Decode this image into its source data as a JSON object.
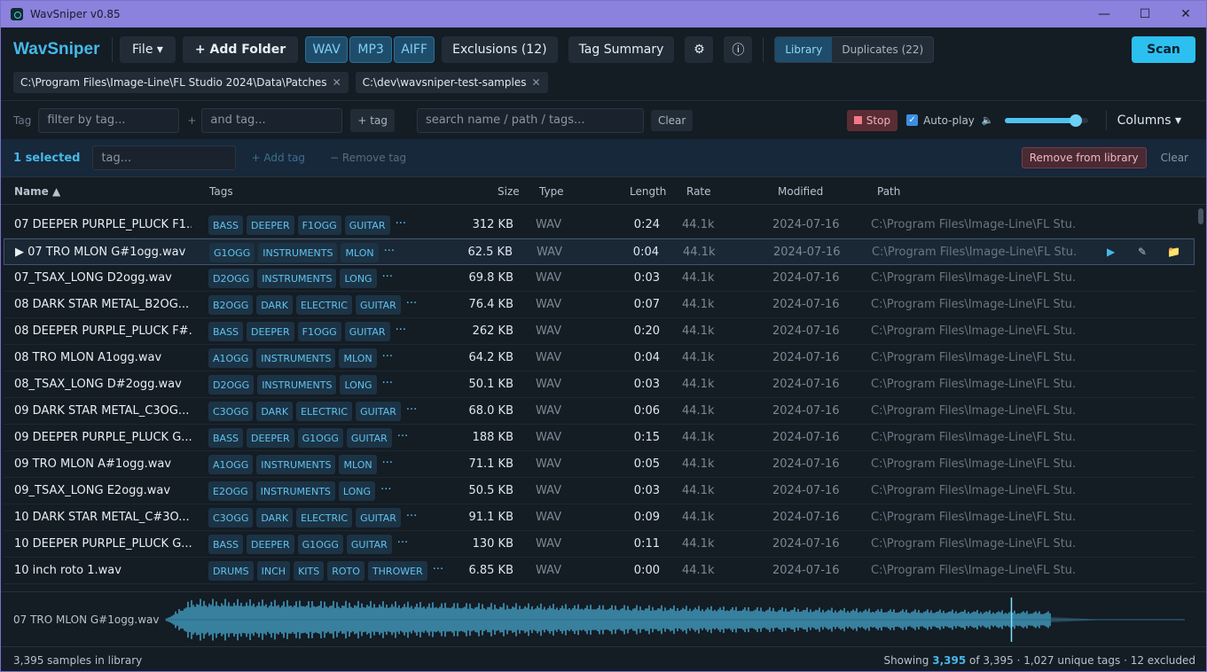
{
  "window": {
    "title": "WavSniper v0.85",
    "min": "—",
    "max": "☐",
    "close": "✕"
  },
  "toolbar": {
    "brand": "WavSniper",
    "file": "File ▾",
    "add_folder": "+ Add Folder",
    "formats": [
      "WAV",
      "MP3",
      "AIFF"
    ],
    "exclusions": "Exclusions (12)",
    "tag_summary": "Tag Summary",
    "settings_icon": "⚙",
    "info_icon": "ⓘ",
    "view_library": "Library",
    "view_duplicates": "Duplicates (22)",
    "scan": "Scan"
  },
  "paths": [
    {
      "label": "C:\\Program Files\\Image-Line\\FL Studio 2024\\Data\\Patches",
      "remove": "✕"
    },
    {
      "label": "C:\\dev\\wavsniper-test-samples",
      "remove": "✕"
    }
  ],
  "filters": {
    "tag_label": "Tag",
    "tag_placeholder": "filter by tag...",
    "plus": "+",
    "and_tag_placeholder": "and tag...",
    "add_tag_btn": "+ tag",
    "search_placeholder": "search name / path / tags...",
    "clear": "Clear",
    "stop": "Stop",
    "autoplay": "Auto-play",
    "volume_icon": "🔈",
    "volume": 0.85,
    "columns": "Columns ▾"
  },
  "selection": {
    "count": "1 selected",
    "tag_placeholder": "tag...",
    "add_tag": "+ Add tag",
    "remove_tag": "− Remove tag",
    "remove_from_library": "Remove from library",
    "clear": "Clear"
  },
  "columns": {
    "name": "Name ▲",
    "tags": "Tags",
    "size": "Size",
    "type": "Type",
    "length": "Length",
    "rate": "Rate",
    "modified": "Modified",
    "path": "Path"
  },
  "rows": [
    {
      "name": "07 DEEPER PURPLE_PLUCK F1...",
      "tags": [
        "BASS",
        "DEEPER",
        "F1OGG",
        "GUITAR"
      ],
      "size": "312 KB",
      "type": "WAV",
      "length": "0:24",
      "rate": "44.1k",
      "modified": "2024-07-16",
      "path": "C:\\Program Files\\Image-Line\\FL Stu..."
    },
    {
      "name": "▶ 07 TRO MLON G#1ogg.wav",
      "tags": [
        "G1OGG",
        "INSTRUMENTS",
        "MLON"
      ],
      "size": "62.5 KB",
      "type": "WAV",
      "length": "0:04",
      "rate": "44.1k",
      "modified": "2024-07-16",
      "path": "C:\\Program Files\\Image-Line\\FL Stu...",
      "selected": true
    },
    {
      "name": "07_TSAX_LONG D2ogg.wav",
      "tags": [
        "D2OGG",
        "INSTRUMENTS",
        "LONG"
      ],
      "size": "69.8 KB",
      "type": "WAV",
      "length": "0:03",
      "rate": "44.1k",
      "modified": "2024-07-16",
      "path": "C:\\Program Files\\Image-Line\\FL Stu..."
    },
    {
      "name": "08 DARK STAR METAL_B2OG...",
      "tags": [
        "B2OGG",
        "DARK",
        "ELECTRIC",
        "GUITAR"
      ],
      "size": "76.4 KB",
      "type": "WAV",
      "length": "0:07",
      "rate": "44.1k",
      "modified": "2024-07-16",
      "path": "C:\\Program Files\\Image-Line\\FL Stu..."
    },
    {
      "name": "08 DEEPER PURPLE_PLUCK F#...",
      "tags": [
        "BASS",
        "DEEPER",
        "F1OGG",
        "GUITAR"
      ],
      "size": "262 KB",
      "type": "WAV",
      "length": "0:20",
      "rate": "44.1k",
      "modified": "2024-07-16",
      "path": "C:\\Program Files\\Image-Line\\FL Stu..."
    },
    {
      "name": "08 TRO MLON A1ogg.wav",
      "tags": [
        "A1OGG",
        "INSTRUMENTS",
        "MLON"
      ],
      "size": "64.2 KB",
      "type": "WAV",
      "length": "0:04",
      "rate": "44.1k",
      "modified": "2024-07-16",
      "path": "C:\\Program Files\\Image-Line\\FL Stu..."
    },
    {
      "name": "08_TSAX_LONG D#2ogg.wav",
      "tags": [
        "D2OGG",
        "INSTRUMENTS",
        "LONG"
      ],
      "size": "50.1 KB",
      "type": "WAV",
      "length": "0:03",
      "rate": "44.1k",
      "modified": "2024-07-16",
      "path": "C:\\Program Files\\Image-Line\\FL Stu..."
    },
    {
      "name": "09 DARK STAR METAL_C3OG...",
      "tags": [
        "C3OGG",
        "DARK",
        "ELECTRIC",
        "GUITAR"
      ],
      "size": "68.0 KB",
      "type": "WAV",
      "length": "0:06",
      "rate": "44.1k",
      "modified": "2024-07-16",
      "path": "C:\\Program Files\\Image-Line\\FL Stu..."
    },
    {
      "name": "09 DEEPER PURPLE_PLUCK G...",
      "tags": [
        "BASS",
        "DEEPER",
        "G1OGG",
        "GUITAR"
      ],
      "size": "188 KB",
      "type": "WAV",
      "length": "0:15",
      "rate": "44.1k",
      "modified": "2024-07-16",
      "path": "C:\\Program Files\\Image-Line\\FL Stu..."
    },
    {
      "name": "09 TRO MLON A#1ogg.wav",
      "tags": [
        "A1OGG",
        "INSTRUMENTS",
        "MLON"
      ],
      "size": "71.1 KB",
      "type": "WAV",
      "length": "0:05",
      "rate": "44.1k",
      "modified": "2024-07-16",
      "path": "C:\\Program Files\\Image-Line\\FL Stu..."
    },
    {
      "name": "09_TSAX_LONG E2ogg.wav",
      "tags": [
        "E2OGG",
        "INSTRUMENTS",
        "LONG"
      ],
      "size": "50.5 KB",
      "type": "WAV",
      "length": "0:03",
      "rate": "44.1k",
      "modified": "2024-07-16",
      "path": "C:\\Program Files\\Image-Line\\FL Stu..."
    },
    {
      "name": "10 DARK STAR METAL_C#3O...",
      "tags": [
        "C3OGG",
        "DARK",
        "ELECTRIC",
        "GUITAR"
      ],
      "size": "91.1 KB",
      "type": "WAV",
      "length": "0:09",
      "rate": "44.1k",
      "modified": "2024-07-16",
      "path": "C:\\Program Files\\Image-Line\\FL Stu..."
    },
    {
      "name": "10 DEEPER PURPLE_PLUCK G...",
      "tags": [
        "BASS",
        "DEEPER",
        "G1OGG",
        "GUITAR"
      ],
      "size": "130 KB",
      "type": "WAV",
      "length": "0:11",
      "rate": "44.1k",
      "modified": "2024-07-16",
      "path": "C:\\Program Files\\Image-Line\\FL Stu..."
    },
    {
      "name": "10 inch roto 1.wav",
      "tags": [
        "DRUMS",
        "INCH",
        "KITS",
        "ROTO",
        "THROWER"
      ],
      "size": "6.85 KB",
      "type": "WAV",
      "length": "0:00",
      "rate": "44.1k",
      "modified": "2024-07-16",
      "path": "C:\\Program Files\\Image-Line\\FL Stu..."
    }
  ],
  "row_actions": {
    "play": "▶",
    "edit": "✎",
    "folder": "📁"
  },
  "more_tags": "···",
  "waveform": {
    "file": "07 TRO MLON G#1ogg.wav",
    "playhead": 0.83,
    "color": "#4fc3f0"
  },
  "status": {
    "left": "3,395 samples in library",
    "showing_prefix": "Showing",
    "showing_count": "3,395",
    "showing_suffix": "of 3,395 · 1,027 unique tags · 12 excluded"
  }
}
